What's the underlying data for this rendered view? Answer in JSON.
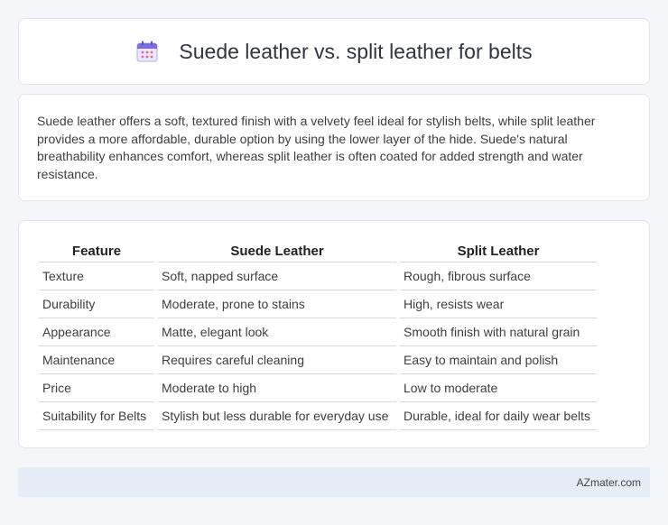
{
  "header": {
    "title": "Suede leather vs. split leather for belts",
    "icon": "calendar-icon"
  },
  "intro": {
    "text": "Suede leather offers a soft, textured finish with a velvety feel ideal for stylish belts, while split leather provides a more affordable, durable option by using the lower layer of the hide. Suede's natural breathability enhances comfort, whereas split leather is often coated for added strength and water resistance."
  },
  "table": {
    "headers": [
      "Feature",
      "Suede Leather",
      "Split Leather"
    ],
    "rows": [
      [
        "Texture",
        "Soft, napped surface",
        "Rough, fibrous surface"
      ],
      [
        "Durability",
        "Moderate, prone to stains",
        "High, resists wear"
      ],
      [
        "Appearance",
        "Matte, elegant look",
        "Smooth finish with natural grain"
      ],
      [
        "Maintenance",
        "Requires careful cleaning",
        "Easy to maintain and polish"
      ],
      [
        "Price",
        "Moderate to high",
        "Low to moderate"
      ],
      [
        "Suitability for Belts",
        "Stylish but less durable for everyday use",
        "Durable, ideal for daily wear belts"
      ]
    ]
  },
  "footer": {
    "site": "AZmater.com"
  }
}
